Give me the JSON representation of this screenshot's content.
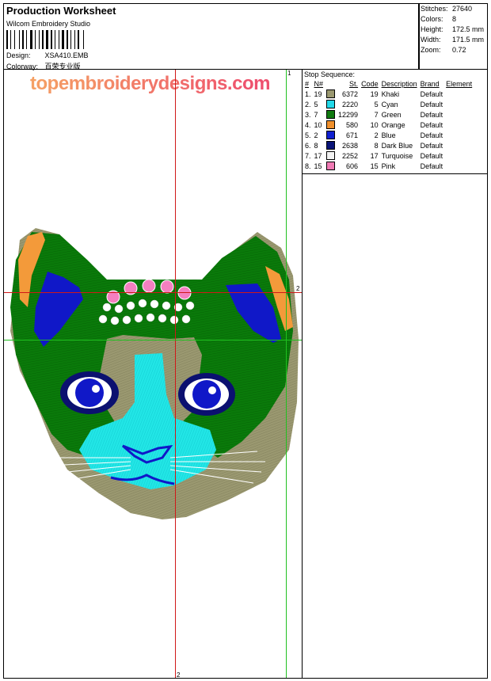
{
  "header": {
    "title": "Production Worksheet",
    "software": "Wilcom  Embroidery Studio",
    "design_label": "Design:",
    "design_value": "XSA410.EMB",
    "colorway_label": "Colorway:",
    "colorway_value": "百荣专业版"
  },
  "stats": {
    "stitches_label": "Stitches:",
    "stitches_value": "27640",
    "colors_label": "Colors:",
    "colors_value": "8",
    "height_label": "Height:",
    "height_value": "172.5 mm",
    "width_label": "Width:",
    "width_value": "171.5 mm",
    "zoom_label": "Zoom:",
    "zoom_value": "0.72"
  },
  "canvas": {
    "watermark": "topembroiderydesigns.com",
    "marker_red": "2",
    "marker_green": "1",
    "marker_red_h": "2",
    "marker_bottom": "2",
    "thread_colors": {
      "khaki": "#9a9870",
      "green": "#0a7a0a",
      "cyan": "#22e6e6",
      "blue": "#1018c8",
      "dark_blue": "#0b1070",
      "orange": "#f39a3a",
      "turquoise": "#ffffff",
      "pink": "#f47fc0"
    },
    "guide_red": "#d01818",
    "guide_green": "#20c020"
  },
  "stops": {
    "title": "Stop Sequence:",
    "headers": [
      "#",
      "N#",
      "St.",
      "Code",
      "Description",
      "Brand",
      "Element"
    ],
    "rows": [
      {
        "idx": "1.",
        "n": "19",
        "color": "#9a9870",
        "st": "6372",
        "code": "19",
        "desc": "Khaki",
        "brand": "Default",
        "element": ""
      },
      {
        "idx": "2.",
        "n": "5",
        "color": "#22d8e8",
        "st": "2220",
        "code": "5",
        "desc": "Cyan",
        "brand": "Default",
        "element": ""
      },
      {
        "idx": "3.",
        "n": "7",
        "color": "#107a10",
        "st": "12299",
        "code": "7",
        "desc": "Green",
        "brand": "Default",
        "element": ""
      },
      {
        "idx": "4.",
        "n": "10",
        "color": "#f0902c",
        "st": "580",
        "code": "10",
        "desc": "Orange",
        "brand": "Default",
        "element": ""
      },
      {
        "idx": "5.",
        "n": "2",
        "color": "#1020d0",
        "st": "671",
        "code": "2",
        "desc": "Blue",
        "brand": "Default",
        "element": ""
      },
      {
        "idx": "6.",
        "n": "8",
        "color": "#0a1478",
        "st": "2638",
        "code": "8",
        "desc": "Dark Blue",
        "brand": "Default",
        "element": ""
      },
      {
        "idx": "7.",
        "n": "17",
        "color": "#f2f2f2",
        "st": "2252",
        "code": "17",
        "desc": "Turquoise",
        "brand": "Default",
        "element": ""
      },
      {
        "idx": "8.",
        "n": "15",
        "color": "#f07ab4",
        "st": "606",
        "code": "15",
        "desc": "Pink",
        "brand": "Default",
        "element": ""
      }
    ]
  }
}
